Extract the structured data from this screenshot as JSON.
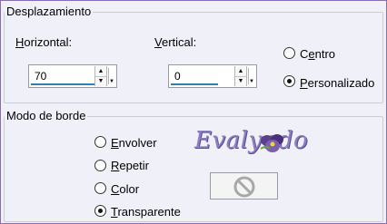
{
  "desplazamiento": {
    "legend": "Desplazamiento",
    "horizontal": {
      "label_u": "H",
      "label_rest": "orizontal:",
      "value": "70"
    },
    "vertical": {
      "label_u": "V",
      "label_rest": "ertical:",
      "value": "0"
    },
    "centro": {
      "pre": "C",
      "u": "e",
      "post": "ntro",
      "selected": false
    },
    "personalizado": {
      "pre": "",
      "u": "P",
      "post": "ersonalizado",
      "selected": true
    }
  },
  "modo_borde": {
    "legend": "Modo de borde",
    "options": [
      {
        "u": "E",
        "rest": "nvolver",
        "selected": false
      },
      {
        "u": "R",
        "rest": "epetir",
        "selected": false
      },
      {
        "u": "C",
        "rest": "olor",
        "selected": false
      },
      {
        "u": "T",
        "rest": "ransparente",
        "selected": true
      }
    ]
  },
  "watermark": {
    "text": "Evalyndo"
  },
  "colors": {
    "accent_line": "#2f7fb1",
    "frame": "#8a6bb4",
    "logo": "#8b7fc0"
  },
  "icons": {
    "spin_up": "triangle-up",
    "spin_down": "triangle-down",
    "color_disabled": "no-symbol"
  }
}
